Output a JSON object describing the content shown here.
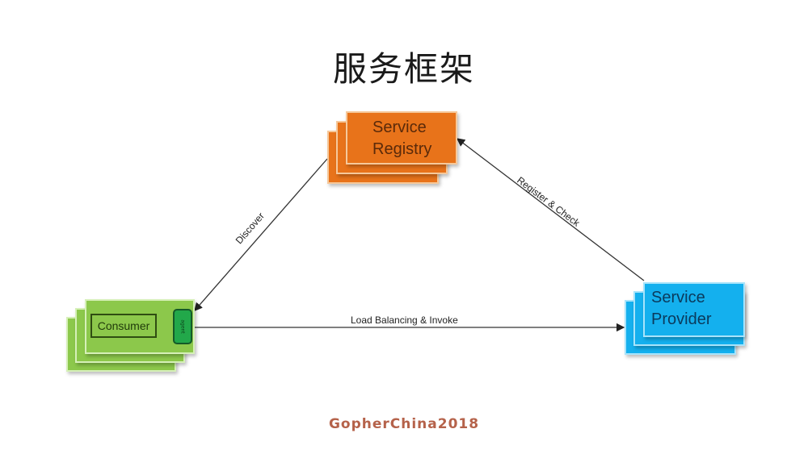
{
  "title": "服务框架",
  "nodes": {
    "registry": {
      "line1": "Service",
      "line2": "Registry",
      "color": "#e8731a"
    },
    "consumer": {
      "label": "Consumer",
      "agent": "agent",
      "color": "#8cc84b"
    },
    "provider": {
      "line1": "Service",
      "line2": "Provider",
      "color": "#14b0ee"
    }
  },
  "edges": {
    "discover": "Discover",
    "register": "Register & Check",
    "invoke": "Load Balancing & Invoke"
  },
  "footer": "GopherChina2018"
}
